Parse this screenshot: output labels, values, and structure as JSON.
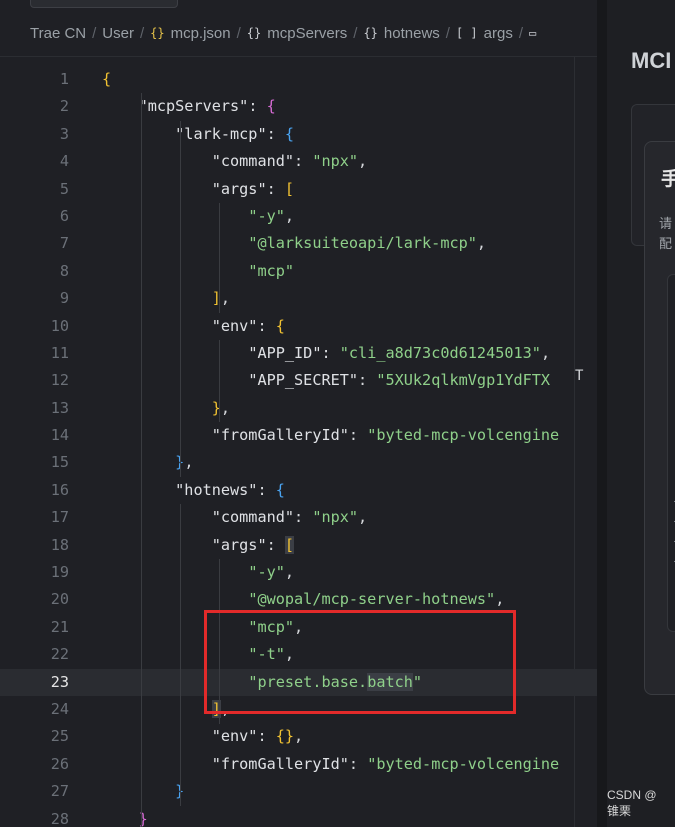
{
  "breadcrumb": {
    "items": [
      {
        "icon": "",
        "label": "Trae CN"
      },
      {
        "icon": "",
        "label": "User"
      },
      {
        "icon": "{}",
        "label": "mcp.json"
      },
      {
        "icon": "{}",
        "label": "mcpServers"
      },
      {
        "icon": "{}",
        "label": "hotnews"
      },
      {
        "icon": "[ ]",
        "label": "args"
      }
    ],
    "trailing_icon": "symbol-icon"
  },
  "editor": {
    "current_line": 23,
    "lines": [
      {
        "n": "1",
        "parts": [
          [
            "b1",
            "{"
          ]
        ]
      },
      {
        "n": "2",
        "parts": [
          [
            "p",
            "    "
          ],
          [
            "k",
            "\"mcpServers\""
          ],
          [
            "p",
            ": "
          ],
          [
            "b2",
            "{"
          ]
        ]
      },
      {
        "n": "3",
        "parts": [
          [
            "p",
            "        "
          ],
          [
            "k",
            "\"lark-mcp\""
          ],
          [
            "p",
            ": "
          ],
          [
            "b3",
            "{"
          ]
        ]
      },
      {
        "n": "4",
        "parts": [
          [
            "p",
            "            "
          ],
          [
            "k",
            "\"command\""
          ],
          [
            "p",
            ": "
          ],
          [
            "s",
            "\"npx\""
          ],
          [
            "p",
            ","
          ]
        ]
      },
      {
        "n": "5",
        "parts": [
          [
            "p",
            "            "
          ],
          [
            "k",
            "\"args\""
          ],
          [
            "p",
            ": "
          ],
          [
            "b1",
            "["
          ]
        ]
      },
      {
        "n": "6",
        "parts": [
          [
            "p",
            "                "
          ],
          [
            "s",
            "\"-y\""
          ],
          [
            "p",
            ","
          ]
        ]
      },
      {
        "n": "7",
        "parts": [
          [
            "p",
            "                "
          ],
          [
            "s",
            "\"@larksuiteoapi/lark-mcp\""
          ],
          [
            "p",
            ","
          ]
        ]
      },
      {
        "n": "8",
        "parts": [
          [
            "p",
            "                "
          ],
          [
            "s",
            "\"mcp\""
          ]
        ]
      },
      {
        "n": "9",
        "parts": [
          [
            "p",
            "            "
          ],
          [
            "b1",
            "]"
          ],
          [
            "p",
            ","
          ]
        ]
      },
      {
        "n": "10",
        "parts": [
          [
            "p",
            "            "
          ],
          [
            "k",
            "\"env\""
          ],
          [
            "p",
            ": "
          ],
          [
            "b1",
            "{"
          ]
        ]
      },
      {
        "n": "11",
        "parts": [
          [
            "p",
            "                "
          ],
          [
            "k",
            "\"APP_ID\""
          ],
          [
            "p",
            ": "
          ],
          [
            "s",
            "\"cli_a8d73c0d61245013\""
          ],
          [
            "p",
            ","
          ]
        ]
      },
      {
        "n": "12",
        "parts": [
          [
            "p",
            "                "
          ],
          [
            "k",
            "\"APP_SECRET\""
          ],
          [
            "p",
            ": "
          ],
          [
            "s",
            "\"5XUk2qlkmVgp1YdFTX"
          ]
        ]
      },
      {
        "n": "13",
        "parts": [
          [
            "p",
            "            "
          ],
          [
            "b1",
            "}"
          ],
          [
            "p",
            ","
          ]
        ]
      },
      {
        "n": "14",
        "parts": [
          [
            "p",
            "            "
          ],
          [
            "k",
            "\"fromGalleryId\""
          ],
          [
            "p",
            ": "
          ],
          [
            "s",
            "\"byted-mcp-volcengine"
          ]
        ]
      },
      {
        "n": "15",
        "parts": [
          [
            "p",
            "        "
          ],
          [
            "b3",
            "}"
          ],
          [
            "p",
            ","
          ]
        ]
      },
      {
        "n": "16",
        "parts": [
          [
            "p",
            "        "
          ],
          [
            "k",
            "\"hotnews\""
          ],
          [
            "p",
            ": "
          ],
          [
            "b3",
            "{"
          ]
        ]
      },
      {
        "n": "17",
        "parts": [
          [
            "p",
            "            "
          ],
          [
            "k",
            "\"command\""
          ],
          [
            "p",
            ": "
          ],
          [
            "s",
            "\"npx\""
          ],
          [
            "p",
            ","
          ]
        ]
      },
      {
        "n": "18",
        "parts": [
          [
            "p",
            "            "
          ],
          [
            "k",
            "\"args\""
          ],
          [
            "p",
            ": "
          ],
          [
            "b1sel",
            "["
          ]
        ]
      },
      {
        "n": "19",
        "parts": [
          [
            "p",
            "                "
          ],
          [
            "s",
            "\"-y\""
          ],
          [
            "p",
            ","
          ]
        ]
      },
      {
        "n": "20",
        "parts": [
          [
            "p",
            "                "
          ],
          [
            "s",
            "\"@wopal/mcp-server-hotnews\""
          ],
          [
            "p",
            ","
          ]
        ]
      },
      {
        "n": "21",
        "parts": [
          [
            "p",
            "                "
          ],
          [
            "s",
            "\"mcp\""
          ],
          [
            "p",
            ","
          ]
        ]
      },
      {
        "n": "22",
        "parts": [
          [
            "p",
            "                "
          ],
          [
            "s",
            "\"-t\""
          ],
          [
            "p",
            ","
          ]
        ]
      },
      {
        "n": "23",
        "parts": [
          [
            "p",
            "                "
          ],
          [
            "s",
            "\"preset.base."
          ],
          [
            "ssel",
            "batch"
          ],
          [
            "s",
            "\""
          ]
        ]
      },
      {
        "n": "24",
        "parts": [
          [
            "p",
            "            "
          ],
          [
            "b1sel",
            "]"
          ],
          [
            "p",
            ","
          ]
        ]
      },
      {
        "n": "25",
        "parts": [
          [
            "p",
            "            "
          ],
          [
            "k",
            "\"env\""
          ],
          [
            "p",
            ": "
          ],
          [
            "b1",
            "{}"
          ],
          [
            "p",
            ","
          ]
        ]
      },
      {
        "n": "26",
        "parts": [
          [
            "p",
            "            "
          ],
          [
            "k",
            "\"fromGalleryId\""
          ],
          [
            "p",
            ": "
          ],
          [
            "s",
            "\"byted-mcp-volcengine"
          ]
        ]
      },
      {
        "n": "27",
        "parts": [
          [
            "p",
            "        "
          ],
          [
            "b3",
            "}"
          ]
        ]
      },
      {
        "n": "28",
        "parts": [
          [
            "p",
            "    "
          ],
          [
            "b2",
            "}"
          ]
        ]
      }
    ]
  },
  "right_panel": {
    "title": "MCI",
    "dialog_title": "手",
    "dialog_text_1": "请",
    "dialog_text_2": "配"
  },
  "watermark": "CSDN @锥栗",
  "colors": {
    "highlight_box": "#e22a2a",
    "string": "#8fd08a",
    "key": "#dfe1e5"
  }
}
